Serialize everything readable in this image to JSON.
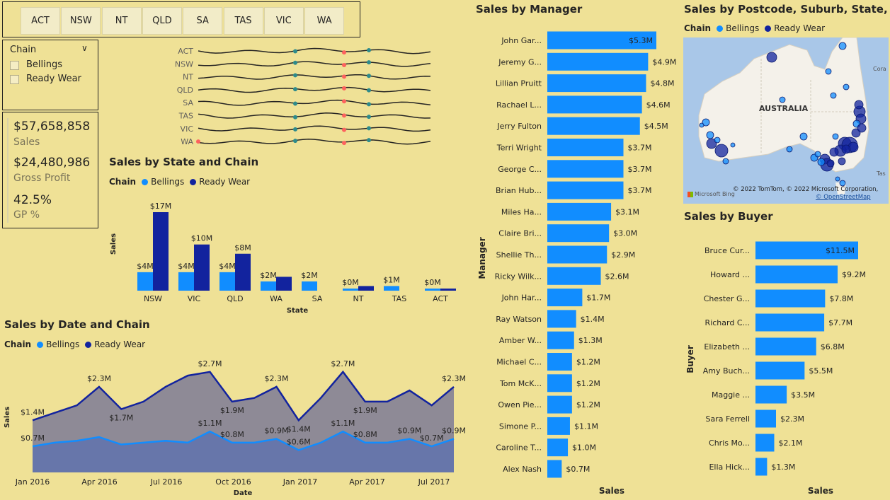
{
  "state_slicer": [
    "ACT",
    "NSW",
    "NT",
    "QLD",
    "SA",
    "TAS",
    "VIC",
    "WA"
  ],
  "chain_filter": {
    "label": "Chain",
    "options": [
      "Bellings",
      "Ready Wear"
    ]
  },
  "kpis": [
    {
      "value": "$57,658,858",
      "label": "Sales"
    },
    {
      "value": "$24,480,986",
      "label": "Gross Profit"
    },
    {
      "value": "42.5%",
      "label": "GP %"
    }
  ],
  "colors": {
    "bellings": "#118dff",
    "ready_wear": "#12239e",
    "background": "#efe196",
    "teal": "#2e8b8b",
    "red": "#fd625e"
  },
  "sparkline_states": [
    "ACT",
    "NSW",
    "NT",
    "QLD",
    "SA",
    "TAS",
    "VIC",
    "WA"
  ],
  "legend_chain": {
    "label": "Chain",
    "bellings": "Bellings",
    "ready_wear": "Ready Wear"
  },
  "state_chart": {
    "title": "Sales by State and Chain",
    "chart_data": {
      "type": "bar",
      "categories": [
        "NSW",
        "VIC",
        "QLD",
        "WA",
        "SA",
        "NT",
        "TAS",
        "ACT"
      ],
      "series": [
        {
          "name": "Bellings",
          "values": [
            4,
            4,
            4,
            2,
            2,
            0.3,
            1,
            0.2
          ],
          "labels": [
            "$4M",
            "$4M",
            "$4M",
            "$2M",
            "$2M",
            "$0M",
            "$1M",
            "$0M"
          ]
        },
        {
          "name": "Ready Wear",
          "values": [
            17,
            10,
            8,
            3,
            0,
            1,
            0,
            0.4
          ],
          "labels": [
            "$17M",
            "$10M",
            "$8M",
            "",
            "",
            "",
            "",
            ""
          ]
        }
      ],
      "xlabel": "State",
      "ylabel": "Sales",
      "ylim": [
        0,
        18
      ]
    }
  },
  "date_chart": {
    "title": "Sales by Date and Chain",
    "chart_data": {
      "type": "area",
      "xlabel": "Date",
      "ylabel": "Sales",
      "ylim": [
        0,
        3.0
      ],
      "x_ticks": [
        "Jan 2016",
        "Apr 2016",
        "Jul 2016",
        "Oct 2016",
        "Jan 2017",
        "Apr 2017",
        "Jul 2017"
      ],
      "series": [
        {
          "name": "Ready Wear",
          "values": [
            1.4,
            1.6,
            1.8,
            2.3,
            1.7,
            1.9,
            2.3,
            2.6,
            2.7,
            1.9,
            2.0,
            2.3,
            1.4,
            2.0,
            2.7,
            1.9,
            1.9,
            2.2,
            1.8,
            2.3
          ]
        },
        {
          "name": "Bellings",
          "values": [
            0.7,
            0.8,
            0.85,
            0.95,
            0.75,
            0.8,
            0.85,
            0.8,
            1.1,
            0.8,
            0.8,
            0.9,
            0.6,
            0.8,
            1.1,
            0.8,
            0.8,
            0.9,
            0.7,
            0.9
          ]
        }
      ],
      "data_labels": [
        {
          "i": 0,
          "s": 0,
          "text": "$1.4M"
        },
        {
          "i": 3,
          "s": 0,
          "text": "$2.3M"
        },
        {
          "i": 4,
          "s": 0,
          "text": "$1.7M"
        },
        {
          "i": 8,
          "s": 0,
          "text": "$2.7M"
        },
        {
          "i": 9,
          "s": 0,
          "text": "$1.9M"
        },
        {
          "i": 11,
          "s": 0,
          "text": "$2.3M"
        },
        {
          "i": 12,
          "s": 0,
          "text": "$1.4M"
        },
        {
          "i": 14,
          "s": 0,
          "text": "$2.7M"
        },
        {
          "i": 15,
          "s": 0,
          "text": "$1.9M"
        },
        {
          "i": 19,
          "s": 0,
          "text": "$2.3M"
        },
        {
          "i": 0,
          "s": 1,
          "text": "$0.7M"
        },
        {
          "i": 8,
          "s": 1,
          "text": "$1.1M"
        },
        {
          "i": 9,
          "s": 1,
          "text": "$0.8M"
        },
        {
          "i": 11,
          "s": 1,
          "text": "$0.9M"
        },
        {
          "i": 12,
          "s": 1,
          "text": "$0.6M"
        },
        {
          "i": 14,
          "s": 1,
          "text": "$1.1M"
        },
        {
          "i": 15,
          "s": 1,
          "text": "$0.8M"
        },
        {
          "i": 17,
          "s": 1,
          "text": "$0.9M"
        },
        {
          "i": 18,
          "s": 1,
          "text": "$0.7M"
        },
        {
          "i": 19,
          "s": 1,
          "text": "$0.9M"
        }
      ]
    }
  },
  "manager_chart": {
    "title": "Sales by Manager",
    "chart_data": {
      "type": "bar",
      "categories": [
        "John Gar...",
        "Jeremy G...",
        "Lillian Pruitt",
        "Rachael L...",
        "Jerry Fulton",
        "Terri Wright",
        "George C...",
        "Brian Hub...",
        "Miles Ha...",
        "Claire Bri...",
        "Shellie Th...",
        "Ricky Wilk...",
        "John Har...",
        "Ray Watson",
        "Amber W...",
        "Michael C...",
        "Tom McK...",
        "Owen Pie...",
        "Simone P...",
        "Caroline T...",
        "Alex Nash"
      ],
      "values": [
        5.3,
        4.9,
        4.8,
        4.6,
        4.5,
        3.7,
        3.7,
        3.7,
        3.1,
        3.0,
        2.9,
        2.6,
        1.7,
        1.4,
        1.3,
        1.2,
        1.2,
        1.2,
        1.1,
        1.0,
        0.7
      ],
      "labels": [
        "$5.3M",
        "$4.9M",
        "$4.8M",
        "$4.6M",
        "$4.5M",
        "$3.7M",
        "$3.7M",
        "$3.7M",
        "$3.1M",
        "$3.0M",
        "$2.9M",
        "$2.6M",
        "$1.7M",
        "$1.4M",
        "$1.3M",
        "$1.2M",
        "$1.2M",
        "$1.2M",
        "$1.1M",
        "$1.0M",
        "$0.7M"
      ],
      "xlabel": "Sales",
      "ylabel": "Manager"
    }
  },
  "map_chart": {
    "title": "Sales by Postcode, Suburb, State, Cou...",
    "country_label": "AUSTRALIA",
    "edge_labels": [
      "Cora",
      "Tas"
    ],
    "copyright": "© 2022 TomTom, © 2022 Microsoft Corporation,",
    "osm": "© OpenStreetMap",
    "bing": "Microsoft Bing"
  },
  "buyer_chart": {
    "title": "Sales by Buyer",
    "chart_data": {
      "type": "bar",
      "categories": [
        "Bruce Cur...",
        "Howard ...",
        "Chester G...",
        "Richard C...",
        "Elizabeth ...",
        "Amy Buch...",
        "Maggie ...",
        "Sara Ferrell",
        "Chris Mo...",
        "Ella Hick..."
      ],
      "values": [
        11.5,
        9.2,
        7.8,
        7.7,
        6.8,
        5.5,
        3.5,
        2.3,
        2.1,
        1.3
      ],
      "labels": [
        "$11.5M",
        "$9.2M",
        "$7.8M",
        "$7.7M",
        "$6.8M",
        "$5.5M",
        "$3.5M",
        "$2.3M",
        "$2.1M",
        "$1.3M"
      ],
      "xlabel": "Sales",
      "ylabel": "Buyer"
    }
  }
}
